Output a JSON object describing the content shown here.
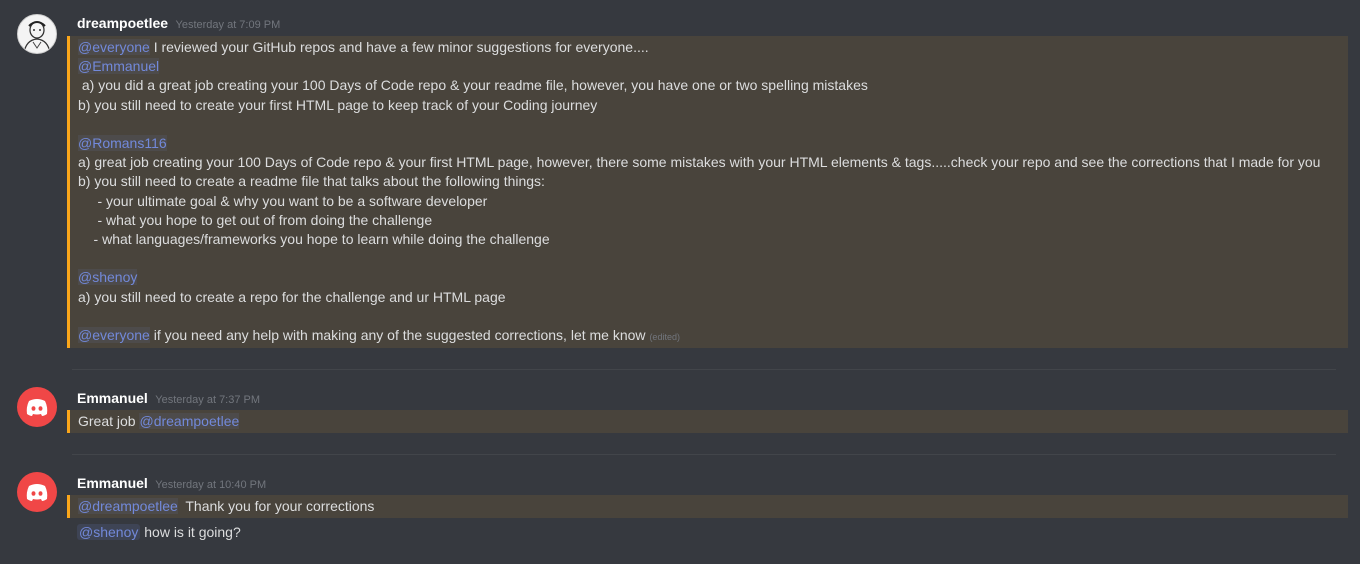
{
  "messages": [
    {
      "username": "dreampoetlee",
      "timestamp": "Yesterday at 7:09 PM",
      "lines": [
        {
          "mention": "@everyone",
          "text": " I reviewed your GitHub repos and have a few minor suggestions for everyone...."
        },
        {
          "mention": "@Emmanuel",
          "text": ""
        },
        {
          "mention": "",
          "text": " a) you did a great job creating your 100 Days of Code repo & your readme file, however, you have one or two spelling mistakes"
        },
        {
          "mention": "",
          "text": "b) you still need to create your first HTML page to keep track of your Coding journey"
        },
        {
          "mention": "",
          "text": ""
        },
        {
          "mention": "@Romans116",
          "text": ""
        },
        {
          "mention": "",
          "text": "a) great job creating your 100 Days of Code repo & your first HTML page, however, there some mistakes with your HTML elements & tags.....check your repo and see the corrections that I made for you"
        },
        {
          "mention": "",
          "text": "b) you still need to create a readme file that talks about the following things:"
        },
        {
          "mention": "",
          "text": "     - your ultimate goal & why you want to be a software developer"
        },
        {
          "mention": "",
          "text": "     - what you hope to get out of from doing the challenge"
        },
        {
          "mention": "",
          "text": "    - what languages/frameworks you hope to learn while doing the challenge"
        },
        {
          "mention": "",
          "text": ""
        },
        {
          "mention": "@shenoy",
          "text": ""
        },
        {
          "mention": "",
          "text": "a) you still need to create a repo for the challenge and ur HTML page"
        },
        {
          "mention": "",
          "text": ""
        },
        {
          "mention": "@everyone",
          "text": " if you need any help with making any of the suggested corrections, let me know"
        }
      ],
      "edited_label": "(edited)"
    },
    {
      "username": "Emmanuel",
      "timestamp": "Yesterday at 7:37 PM",
      "prefix": "Great job ",
      "mention": "@dreampoetlee"
    },
    {
      "username": "Emmanuel",
      "timestamp": "Yesterday at 10:40 PM",
      "mention": "@dreampoetlee",
      "text": "  Thank you for your corrections",
      "followup_mention": "@shenoy",
      "followup_text": " how is it going?"
    }
  ],
  "colors": {
    "background": "#36393f",
    "highlight": "#49443c",
    "highlight_border": "#faa61a",
    "mention": "#7289da",
    "discord_red": "#f04747"
  },
  "icons": {
    "avatar_1": "sketch-portrait-avatar",
    "avatar_2": "discord-logo-icon",
    "avatar_3": "discord-logo-icon"
  }
}
